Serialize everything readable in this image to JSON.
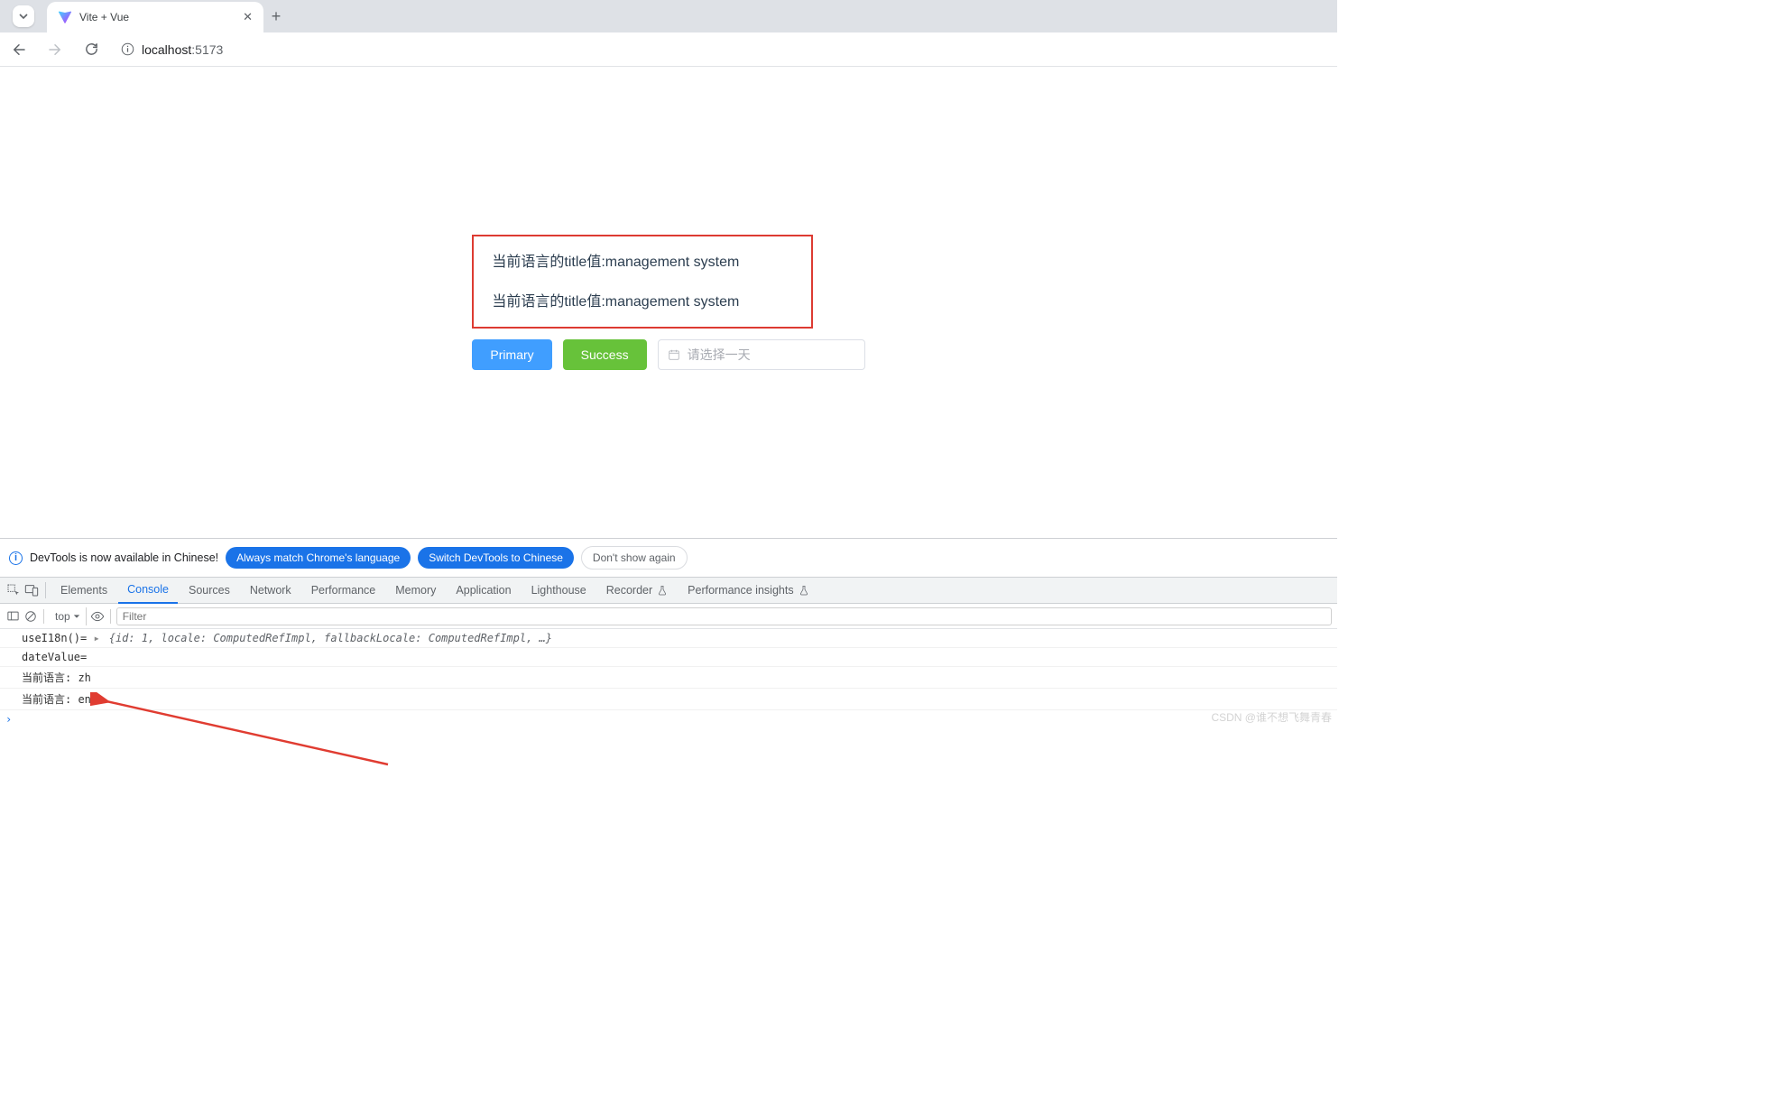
{
  "chrome": {
    "tab_title": "Vite + Vue",
    "url_host": "localhost",
    "url_port": ":5173"
  },
  "content": {
    "line1_prefix": "当前语言的title值:",
    "line1_value": "management system",
    "line2_prefix": "当前语言的title值:",
    "line2_value": "management system",
    "btn_primary": "Primary",
    "btn_success": "Success",
    "date_placeholder": "请选择一天"
  },
  "notice": {
    "text": "DevTools is now available in Chinese!",
    "btn_match": "Always match Chrome's language",
    "btn_switch": "Switch DevTools to Chinese",
    "btn_dont": "Don't show again"
  },
  "devtools": {
    "tabs": {
      "elements": "Elements",
      "console": "Console",
      "sources": "Sources",
      "network": "Network",
      "performance": "Performance",
      "memory": "Memory",
      "application": "Application",
      "lighthouse": "Lighthouse",
      "recorder": "Recorder",
      "perf_insights": "Performance insights"
    },
    "toolbar": {
      "context": "top",
      "filter_placeholder": "Filter"
    },
    "logs": {
      "l0_pre": "useI18n()= ",
      "l0_obj": "{id: 1, locale: ComputedRefImpl, fallbackLocale: ComputedRefImpl, …}",
      "l1": "dateValue=",
      "l2": "当前语言: zh",
      "l3": "当前语言: en"
    }
  },
  "watermark": "CSDN @谁不想飞舞青春"
}
